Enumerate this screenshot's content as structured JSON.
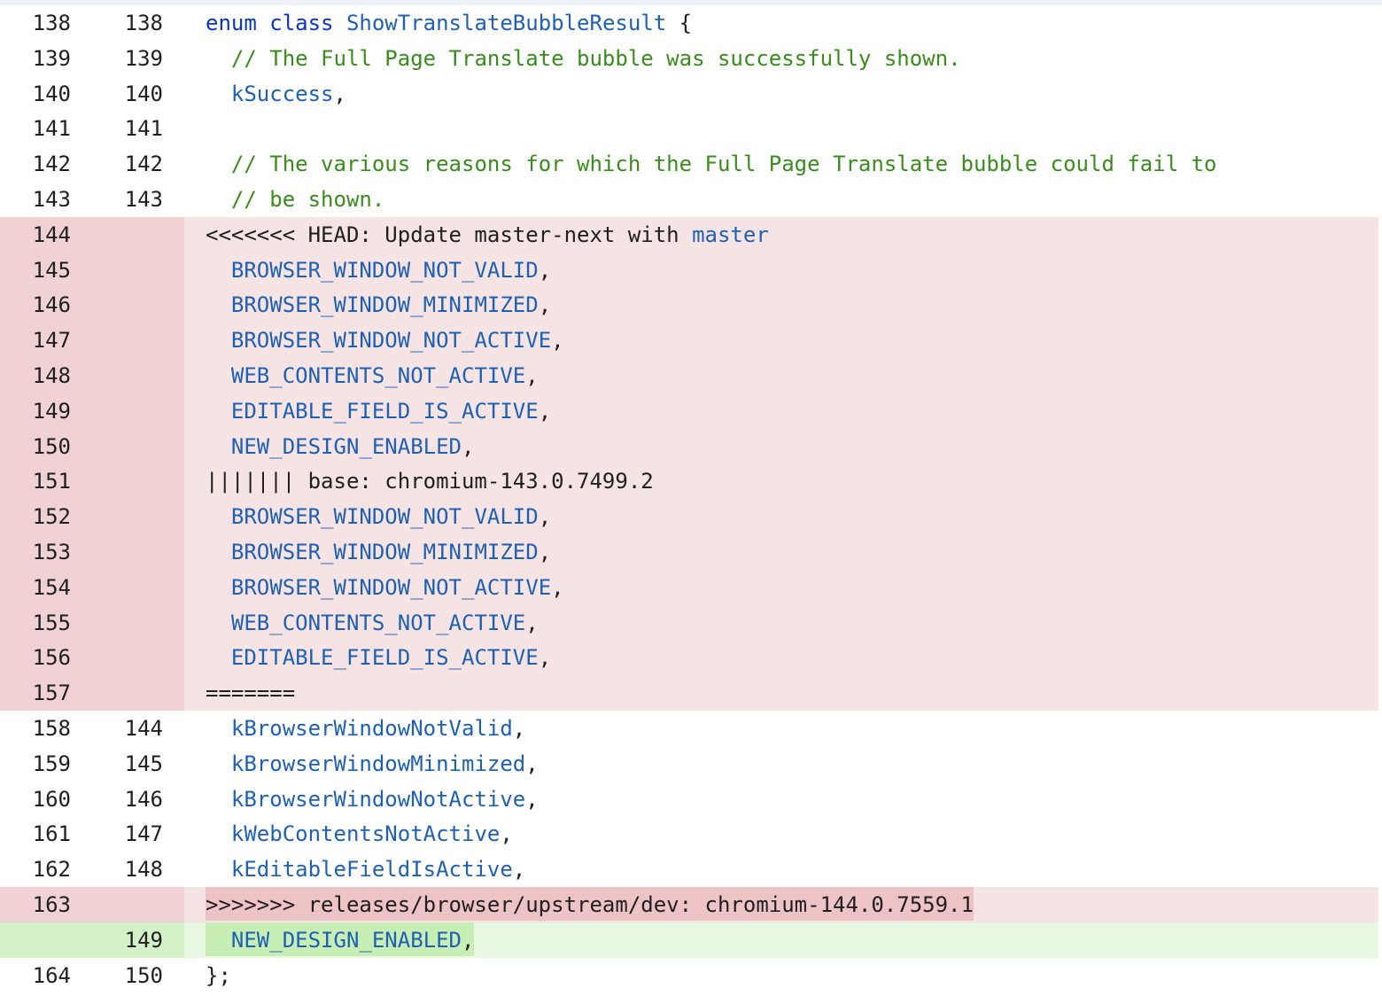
{
  "diff": {
    "colors": {
      "removed_bg": "#f6e3e4",
      "removed_gutter": "#f0d2d4",
      "added_bg": "#e8f7e1",
      "added_gutter": "#d3f1c6",
      "keyword": "#0b34c6",
      "identifier": "#1f60b3",
      "comment": "#3a8c1d"
    },
    "rows": [
      {
        "type": "context",
        "old": "138",
        "new": "138",
        "segments": [
          {
            "t": "enum",
            "c": "kw"
          },
          {
            "t": " "
          },
          {
            "t": "class",
            "c": "kw"
          },
          {
            "t": " "
          },
          {
            "t": "ShowTranslateBubbleResult",
            "c": "id"
          },
          {
            "t": " {"
          }
        ]
      },
      {
        "type": "context",
        "old": "139",
        "new": "139",
        "segments": [
          {
            "t": "  "
          },
          {
            "t": "// The Full Page Translate bubble was successfully shown.",
            "c": "cmt"
          }
        ]
      },
      {
        "type": "context",
        "old": "140",
        "new": "140",
        "segments": [
          {
            "t": "  "
          },
          {
            "t": "kSuccess",
            "c": "id"
          },
          {
            "t": ","
          }
        ]
      },
      {
        "type": "context",
        "old": "141",
        "new": "141",
        "segments": []
      },
      {
        "type": "context",
        "old": "142",
        "new": "142",
        "segments": [
          {
            "t": "  "
          },
          {
            "t": "// The various reasons for which the Full Page Translate bubble could fail to",
            "c": "cmt"
          }
        ]
      },
      {
        "type": "context",
        "old": "143",
        "new": "143",
        "segments": [
          {
            "t": "  "
          },
          {
            "t": "// be shown.",
            "c": "cmt"
          }
        ]
      },
      {
        "type": "removed",
        "old": "144",
        "new": "",
        "segments": [
          {
            "t": "<<<<<<< HEAD: Update master-next with "
          },
          {
            "t": "master",
            "c": "id"
          }
        ]
      },
      {
        "type": "removed",
        "old": "145",
        "new": "",
        "segments": [
          {
            "t": "  "
          },
          {
            "t": "BROWSER_WINDOW_NOT_VALID",
            "c": "id"
          },
          {
            "t": ","
          }
        ]
      },
      {
        "type": "removed",
        "old": "146",
        "new": "",
        "segments": [
          {
            "t": "  "
          },
          {
            "t": "BROWSER_WINDOW_MINIMIZED",
            "c": "id"
          },
          {
            "t": ","
          }
        ]
      },
      {
        "type": "removed",
        "old": "147",
        "new": "",
        "segments": [
          {
            "t": "  "
          },
          {
            "t": "BROWSER_WINDOW_NOT_ACTIVE",
            "c": "id"
          },
          {
            "t": ","
          }
        ]
      },
      {
        "type": "removed",
        "old": "148",
        "new": "",
        "segments": [
          {
            "t": "  "
          },
          {
            "t": "WEB_CONTENTS_NOT_ACTIVE",
            "c": "id"
          },
          {
            "t": ","
          }
        ]
      },
      {
        "type": "removed",
        "old": "149",
        "new": "",
        "segments": [
          {
            "t": "  "
          },
          {
            "t": "EDITABLE_FIELD_IS_ACTIVE",
            "c": "id"
          },
          {
            "t": ","
          }
        ]
      },
      {
        "type": "removed",
        "old": "150",
        "new": "",
        "segments": [
          {
            "t": "  "
          },
          {
            "t": "NEW_DESIGN_ENABLED",
            "c": "id"
          },
          {
            "t": ","
          }
        ]
      },
      {
        "type": "removed",
        "old": "151",
        "new": "",
        "segments": [
          {
            "t": "||||||| base: chromium-143.0.7499.2"
          }
        ]
      },
      {
        "type": "removed",
        "old": "152",
        "new": "",
        "segments": [
          {
            "t": "  "
          },
          {
            "t": "BROWSER_WINDOW_NOT_VALID",
            "c": "id"
          },
          {
            "t": ","
          }
        ]
      },
      {
        "type": "removed",
        "old": "153",
        "new": "",
        "segments": [
          {
            "t": "  "
          },
          {
            "t": "BROWSER_WINDOW_MINIMIZED",
            "c": "id"
          },
          {
            "t": ","
          }
        ]
      },
      {
        "type": "removed",
        "old": "154",
        "new": "",
        "segments": [
          {
            "t": "  "
          },
          {
            "t": "BROWSER_WINDOW_NOT_ACTIVE",
            "c": "id"
          },
          {
            "t": ","
          }
        ]
      },
      {
        "type": "removed",
        "old": "155",
        "new": "",
        "segments": [
          {
            "t": "  "
          },
          {
            "t": "WEB_CONTENTS_NOT_ACTIVE",
            "c": "id"
          },
          {
            "t": ","
          }
        ]
      },
      {
        "type": "removed",
        "old": "156",
        "new": "",
        "segments": [
          {
            "t": "  "
          },
          {
            "t": "EDITABLE_FIELD_IS_ACTIVE",
            "c": "id"
          },
          {
            "t": ","
          }
        ]
      },
      {
        "type": "removed",
        "old": "157",
        "new": "",
        "segments": [
          {
            "t": "======="
          }
        ]
      },
      {
        "type": "context",
        "old": "158",
        "new": "144",
        "segments": [
          {
            "t": "  "
          },
          {
            "t": "kBrowserWindowNotValid",
            "c": "id"
          },
          {
            "t": ","
          }
        ]
      },
      {
        "type": "context",
        "old": "159",
        "new": "145",
        "segments": [
          {
            "t": "  "
          },
          {
            "t": "kBrowserWindowMinimized",
            "c": "id"
          },
          {
            "t": ","
          }
        ]
      },
      {
        "type": "context",
        "old": "160",
        "new": "146",
        "segments": [
          {
            "t": "  "
          },
          {
            "t": "kBrowserWindowNotActive",
            "c": "id"
          },
          {
            "t": ","
          }
        ]
      },
      {
        "type": "context",
        "old": "161",
        "new": "147",
        "segments": [
          {
            "t": "  "
          },
          {
            "t": "kWebContentsNotActive",
            "c": "id"
          },
          {
            "t": ","
          }
        ]
      },
      {
        "type": "context",
        "old": "162",
        "new": "148",
        "segments": [
          {
            "t": "  "
          },
          {
            "t": "kEditableFieldIsActive",
            "c": "id"
          },
          {
            "t": ","
          }
        ]
      },
      {
        "type": "removed",
        "old": "163",
        "new": "",
        "highlight": true,
        "segments": [
          {
            "t": ">>>>>>> releases/browser/upstream/dev: chromium-144.0.7559.1"
          }
        ]
      },
      {
        "type": "added",
        "old": "",
        "new": "149",
        "highlight": true,
        "segments": [
          {
            "t": "  "
          },
          {
            "t": "NEW_DESIGN_ENABLED",
            "c": "id"
          },
          {
            "t": ","
          }
        ]
      },
      {
        "type": "context",
        "old": "164",
        "new": "150",
        "segments": [
          {
            "t": "};"
          }
        ]
      }
    ]
  }
}
